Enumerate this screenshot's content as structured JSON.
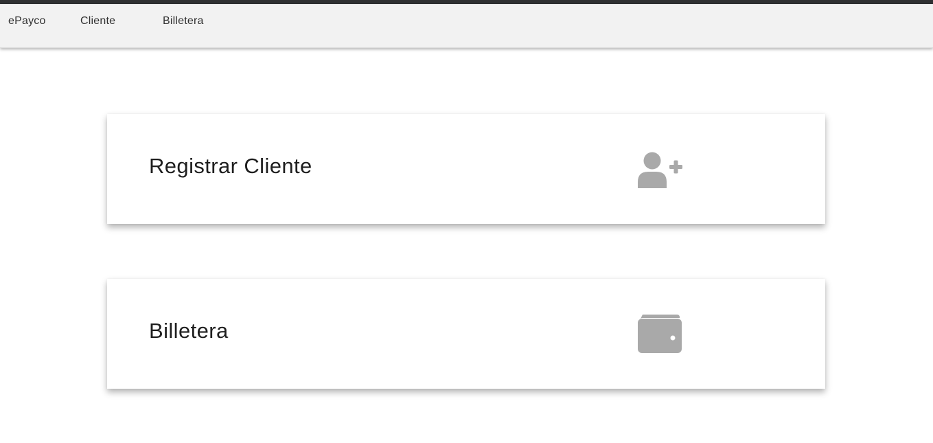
{
  "navbar": {
    "brand": "ePayco",
    "items": [
      {
        "label": "Cliente"
      },
      {
        "label": "Billetera"
      }
    ]
  },
  "cards": [
    {
      "title": "Registrar Cliente",
      "icon": "user-plus-icon"
    },
    {
      "title": "Billetera",
      "icon": "wallet-icon"
    }
  ],
  "colors": {
    "top_strip": "#2f3032",
    "navbar_bg": "#f2f2f2",
    "icon": "#a9a9a9",
    "text": "#1e1e1e"
  }
}
